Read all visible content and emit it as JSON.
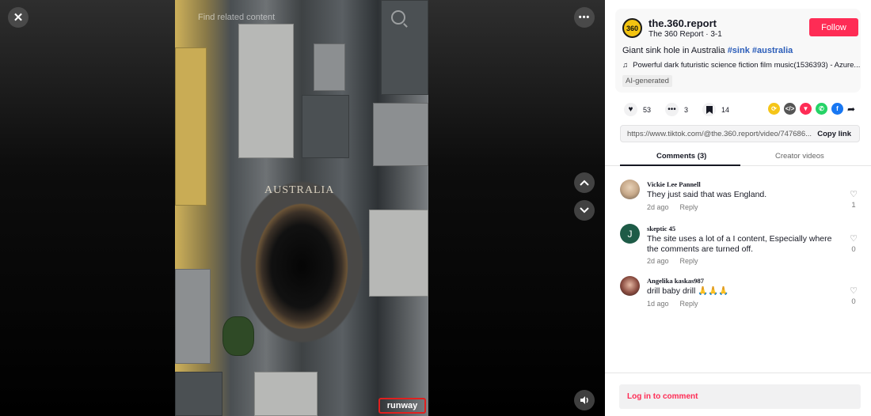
{
  "video": {
    "find_related": "Find related content",
    "overlay_title": "AUSTRALIA",
    "watermark": "runway",
    "icons": [
      "close-icon",
      "more-icon",
      "chevron-up-icon",
      "chevron-down-icon",
      "volume-icon",
      "search-icon"
    ]
  },
  "author": {
    "avatar_text": "360",
    "username": "the.360.report",
    "subtitle": "The 360 Report · 3-1",
    "follow_label": "Follow"
  },
  "caption": {
    "text": "Giant sink hole in Australia ",
    "hashtags": [
      "#sink",
      "#australia"
    ]
  },
  "music": "Powerful dark futuristic science fiction film music(1536393) - Azure...",
  "ai_tag": "AI-generated",
  "stats": {
    "likes": "53",
    "comments": "3",
    "saves": "14"
  },
  "share": {
    "colors": {
      "repost": "#f5c518",
      "embed": "#555555",
      "send": "#fe2c55",
      "whatsapp": "#25d366",
      "facebook": "#1877f2"
    }
  },
  "link": {
    "url": "https://www.tiktok.com/@the.360.report/video/747686...",
    "copy_label": "Copy link"
  },
  "tabs": {
    "comments": "Comments (3)",
    "creator": "Creator videos"
  },
  "comments": [
    {
      "name": "Vickie Lee Pannell",
      "text": "They just said that was England.",
      "age": "2d ago",
      "reply": "Reply",
      "likes": "1"
    },
    {
      "name": "skeptic 45",
      "avatar_letter": "J",
      "text": "The site uses a lot of a I content, Especially where the comments are turned off.",
      "age": "2d ago",
      "reply": "Reply",
      "likes": "0"
    },
    {
      "name": "Angelika kaskas987",
      "text": "drill baby drill 🙏🙏🙏",
      "age": "1d ago",
      "reply": "Reply",
      "likes": "0"
    }
  ],
  "login_label": "Log in to comment",
  "colors": {
    "accent": "#fe2c55",
    "hashtag": "#2b5db9"
  }
}
